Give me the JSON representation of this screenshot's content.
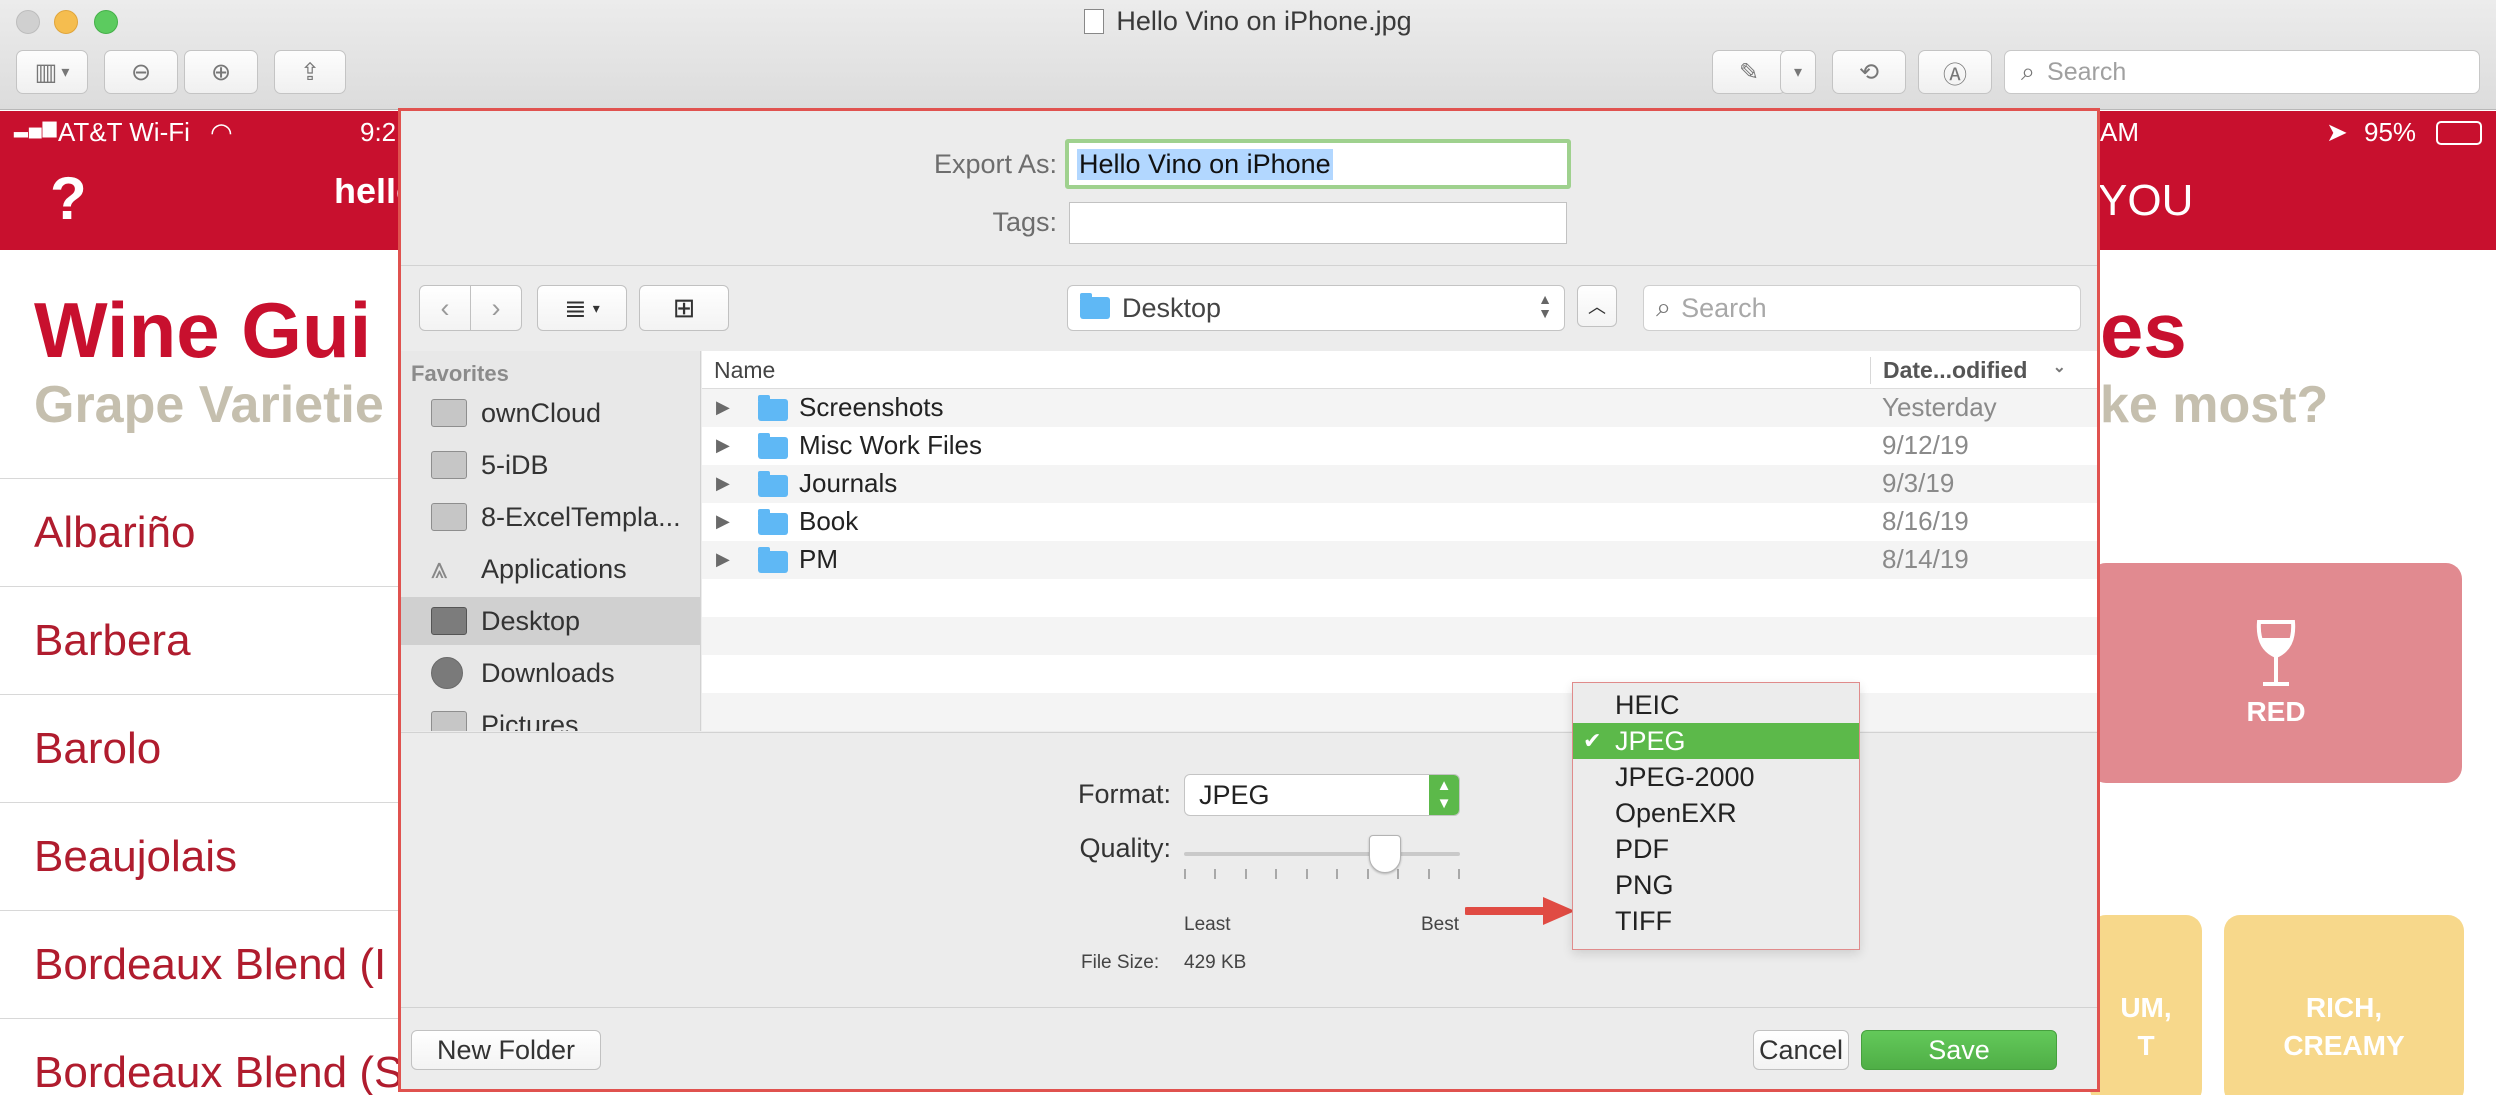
{
  "window": {
    "title": "Hello Vino on iPhone.jpg",
    "search_placeholder": "Search"
  },
  "background": {
    "status": {
      "carrier": "AT&T Wi-Fi",
      "time": "9:2",
      "time_tail": "AM",
      "battery": "95%"
    },
    "header": {
      "help": "?",
      "logo": "hello vino",
      "right_text": "YOU"
    },
    "title": "Wine Gui",
    "subtitle": "Grape Varietie",
    "title_right": "es",
    "subtitle_right": "ke most?",
    "wines": [
      "Albariño",
      "Barbera",
      "Barolo",
      "Beaujolais",
      "Bordeaux Blend (I",
      "Bordeaux Blend (S"
    ],
    "red_tile_label": "RED",
    "tile_left_label": "UM,\nT",
    "tile_right_label": "RICH,\nCREAMY"
  },
  "dialog": {
    "export_as_label": "Export As:",
    "export_as_value": "Hello Vino on iPhone",
    "tags_label": "Tags:",
    "tags_value": "",
    "location": "Desktop",
    "search_placeholder": "Search",
    "sidebar": {
      "heading": "Favorites",
      "items": [
        {
          "label": "ownCloud",
          "icon": "folder-icon"
        },
        {
          "label": "5-iDB",
          "icon": "folder-icon"
        },
        {
          "label": "8-ExcelTempla...",
          "icon": "folder-icon"
        },
        {
          "label": "Applications",
          "icon": "applications-icon"
        },
        {
          "label": "Desktop",
          "icon": "desktop-icon",
          "selected": true
        },
        {
          "label": "Downloads",
          "icon": "downloads-icon"
        },
        {
          "label": "Pictures",
          "icon": "pictures-icon"
        }
      ]
    },
    "columns": {
      "name": "Name",
      "date": "Date...odified"
    },
    "files": [
      {
        "name": "Screenshots",
        "date": "Yesterday"
      },
      {
        "name": "Misc Work Files",
        "date": "9/12/19"
      },
      {
        "name": "Journals",
        "date": "9/3/19"
      },
      {
        "name": "Book",
        "date": "8/16/19"
      },
      {
        "name": "PM",
        "date": "8/14/19"
      }
    ],
    "format_label": "Format:",
    "format_value": "JPEG",
    "quality_label": "Quality:",
    "quality_level": 0.76,
    "quality_least": "Least",
    "quality_best": "Best",
    "file_size_label": "File Size:",
    "file_size_value": "429 KB",
    "format_options": [
      "HEIC",
      "JPEG",
      "JPEG-2000",
      "OpenEXR",
      "PDF",
      "PNG",
      "TIFF"
    ],
    "format_selected": "JPEG",
    "new_folder_label": "New Folder",
    "cancel_label": "Cancel",
    "save_label": "Save"
  },
  "colors": {
    "brand_red": "#c8102e",
    "save_green": "#5cb94a",
    "highlight_border": "#e0524f",
    "arrow": "#e04b43"
  }
}
